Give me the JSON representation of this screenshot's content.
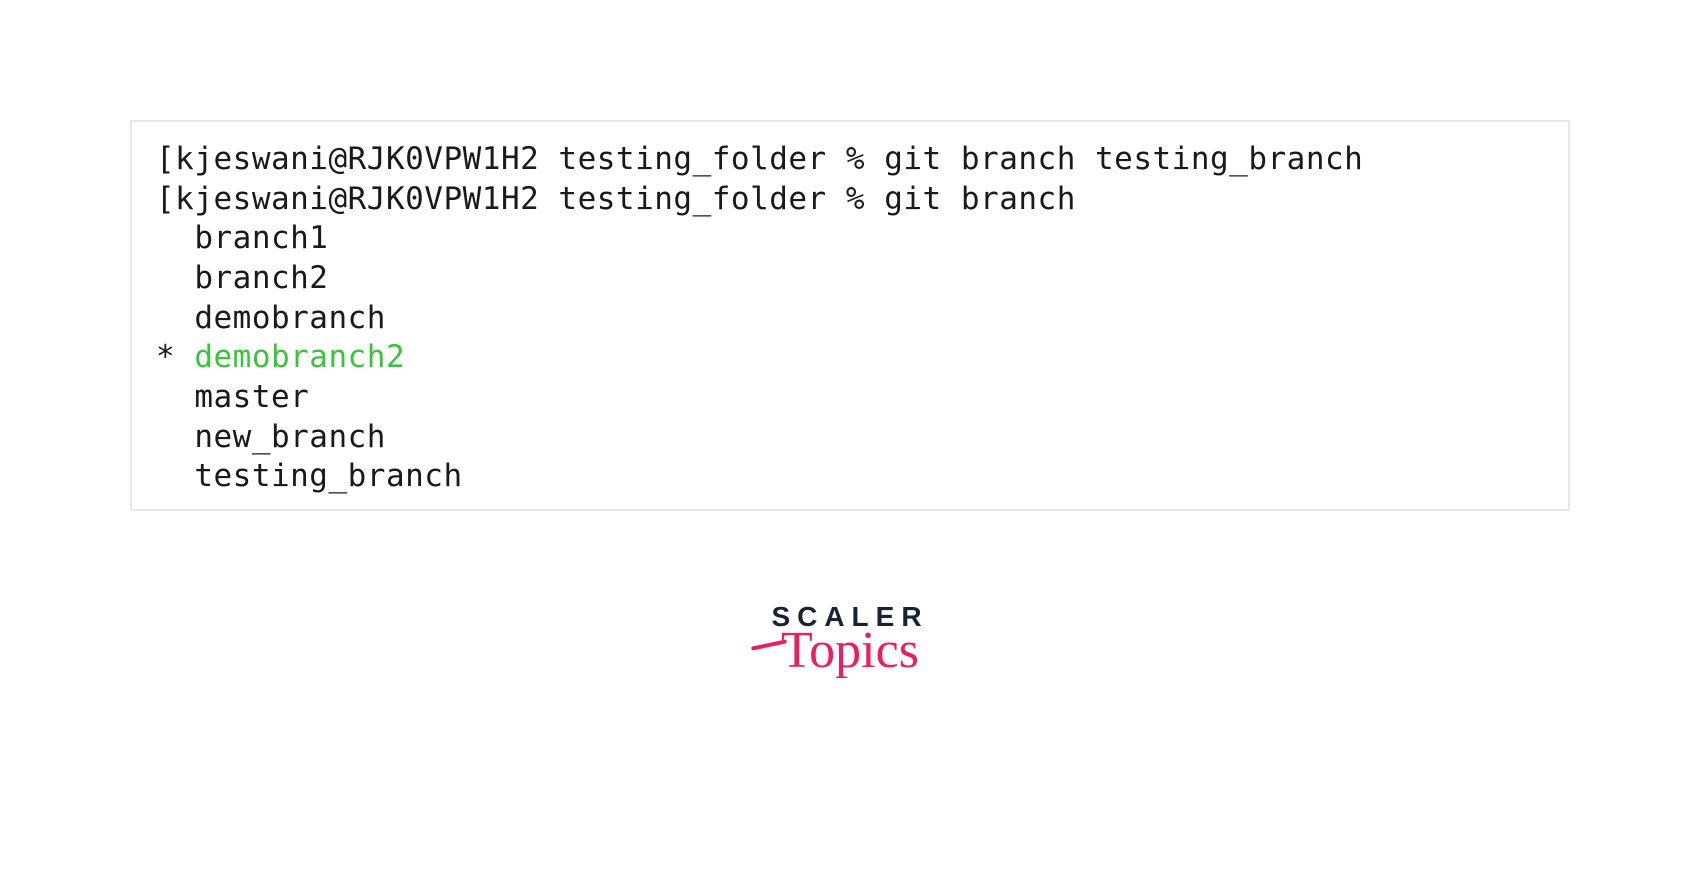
{
  "terminal": {
    "line1": "[kjeswani@RJK0VPW1H2 testing_folder % git branch testing_branch",
    "line2": "[kjeswani@RJK0VPW1H2 testing_folder % git branch",
    "branch1": "  branch1",
    "branch2": "  branch2",
    "branch3": "  demobranch",
    "branch4_prefix": "* ",
    "branch4_name": "demobranch2",
    "branch5": "  master",
    "branch6": "  new_branch",
    "branch7": "  testing_branch"
  },
  "logo": {
    "top": "SCALER",
    "bottom": "Topics"
  }
}
